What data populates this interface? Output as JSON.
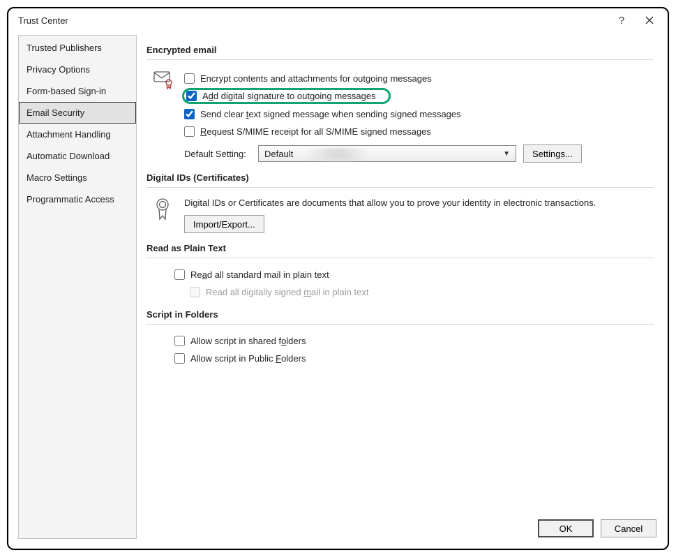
{
  "title": "Trust Center",
  "sidebar": {
    "items": [
      {
        "label": "Trusted Publishers"
      },
      {
        "label": "Privacy Options"
      },
      {
        "label": "Form-based Sign-in"
      },
      {
        "label": "Email Security",
        "selected": true
      },
      {
        "label": "Attachment Handling"
      },
      {
        "label": "Automatic Download"
      },
      {
        "label": "Macro Settings"
      },
      {
        "label": "Programmatic Access"
      }
    ]
  },
  "sections": {
    "encrypted": {
      "heading": "Encrypted email",
      "encrypt_contents": "Encrypt contents and attachments for outgoing messages",
      "add_signature_pre": "A",
      "add_signature_u": "d",
      "add_signature_post": "d digital signature to outgoing messages",
      "send_clear_pre": "Send clear ",
      "send_clear_u": "t",
      "send_clear_post": "ext signed message when sending signed messages",
      "request_pre": "",
      "request_u": "R",
      "request_post": "equest S/MIME receipt for all S/MIME signed messages",
      "default_setting_label": "Default Setting:",
      "default_setting_value": "Default",
      "settings_btn_u": "S",
      "settings_btn_post": "ettings..."
    },
    "digital": {
      "heading": "Digital IDs (Certificates)",
      "desc": "Digital IDs or Certificates are documents that allow you to prove your identity in electronic transactions.",
      "import_btn_u": "I",
      "import_btn_post": "mport/Export..."
    },
    "plaintext": {
      "heading": "Read as Plain Text",
      "read_all_pre": "Re",
      "read_all_u": "a",
      "read_all_post": "d all standard mail in plain text",
      "read_signed_pre": "Read all digitally signed ",
      "read_signed_u": "m",
      "read_signed_post": "ail in plain text"
    },
    "script": {
      "heading": "Script in Folders",
      "shared_pre": "Allow script in shared f",
      "shared_u": "o",
      "shared_post": "lders",
      "public_pre": "Allow script in Public ",
      "public_u": "F",
      "public_post": "olders"
    }
  },
  "footer": {
    "ok": "OK",
    "cancel": "Cancel"
  }
}
